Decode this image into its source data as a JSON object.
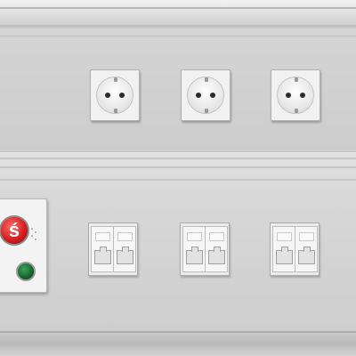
{
  "scene": {
    "description_role": "photo",
    "power_outlets": [
      {
        "id": "outlet-1",
        "icon": "schuko-socket-icon"
      },
      {
        "id": "outlet-2",
        "icon": "schuko-socket-icon"
      },
      {
        "id": "outlet-3",
        "icon": "schuko-socket-icon"
      }
    ],
    "network_modules": [
      {
        "id": "network-module-1",
        "ports": 2,
        "icon": "rj45-jack-icon"
      },
      {
        "id": "network-module-2",
        "ports": 2,
        "icon": "rj45-jack-icon"
      },
      {
        "id": "network-module-3",
        "ports": 2,
        "icon": "rj45-jack-icon"
      }
    ],
    "control_module": {
      "button_icon": "emergency-stop-button-icon",
      "button_color": "#d21a1a",
      "indicator_icon": "status-light-icon",
      "indicator_color": "#0e5a25"
    },
    "panel_color": "#d4d4d4"
  }
}
